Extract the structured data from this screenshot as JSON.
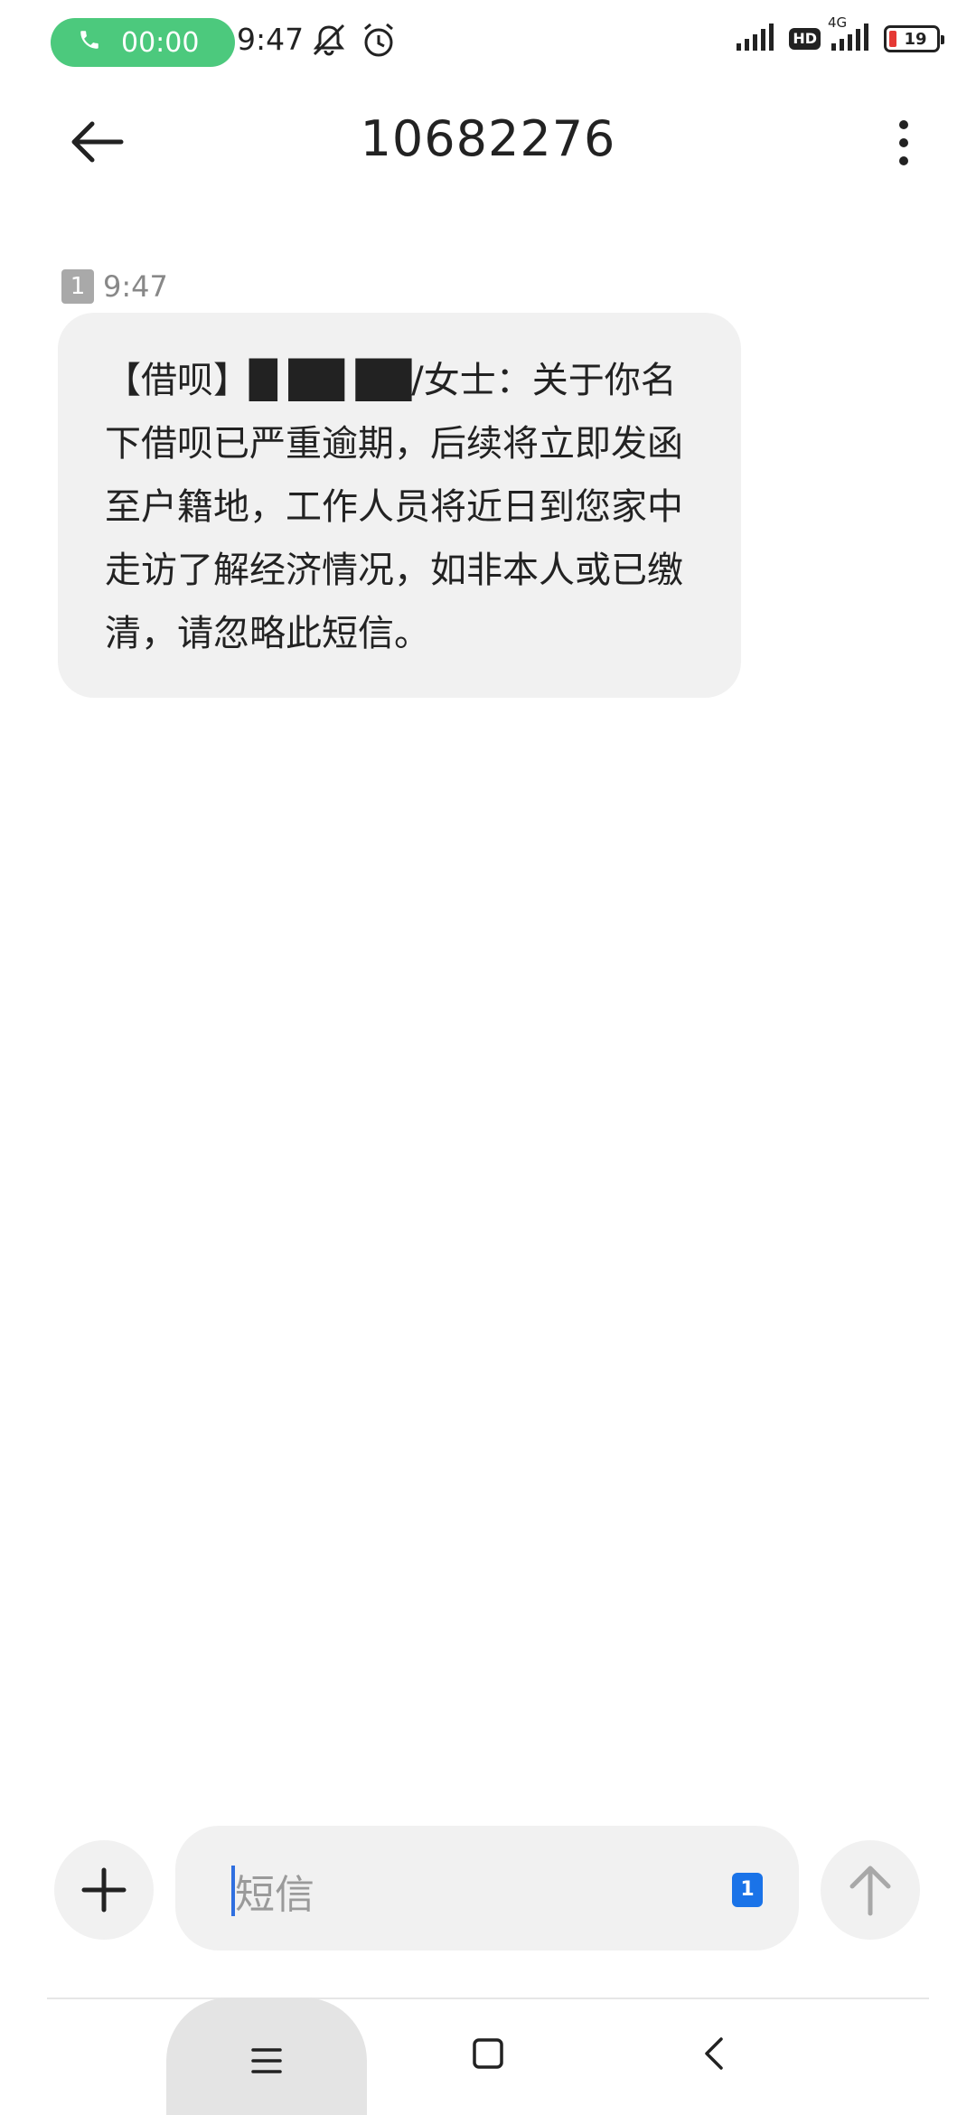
{
  "status_bar": {
    "call_timer": "00:00",
    "time": "9:47",
    "network_badge": "HD",
    "network_type": "4G",
    "battery_level": "19",
    "battery_color": "#e53935",
    "call_pill_color": "#4cc97d",
    "icons": [
      "phone-icon",
      "mute-bell-icon",
      "alarm-icon",
      "signal-icon",
      "signal-icon",
      "battery-icon"
    ]
  },
  "header": {
    "title": "10682276",
    "back_icon": "back-arrow-icon",
    "more_icon": "more-vertical-icon"
  },
  "messages": [
    {
      "sim": "1",
      "time": "9:47",
      "text": "【借呗】█ ██ ██/女士：关于你名下借呗已严重逾期，后续将立即发函至户籍地，工作人员将近日到您家中走访了解经济情况，如非本人或已缴清，请忽略此短信。"
    }
  ],
  "compose": {
    "placeholder": "短信",
    "sim": "1",
    "accent_color": "#1a73e8",
    "add_icon": "plus-icon",
    "send_icon": "send-arrow-icon"
  },
  "nav_bar": {
    "icons": [
      "menu-icon",
      "home-square-icon",
      "back-chevron-icon"
    ]
  }
}
